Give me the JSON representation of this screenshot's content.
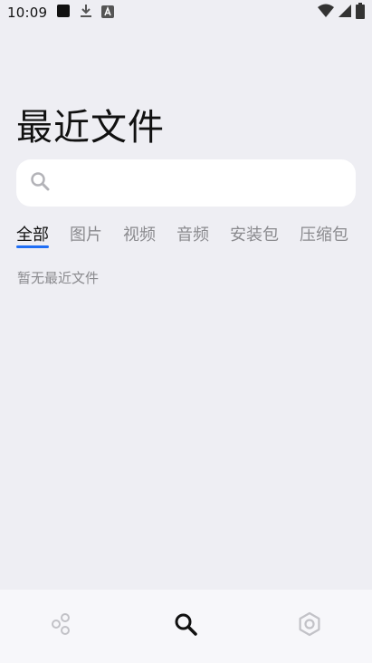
{
  "status_bar": {
    "time": "10:09",
    "left_icons": [
      "square-app-icon",
      "download-icon",
      "font-a-icon"
    ],
    "right_icons": [
      "wifi-icon",
      "signal-icon",
      "battery-icon"
    ]
  },
  "page": {
    "title": "最近文件",
    "empty_message": "暂无最近文件"
  },
  "search": {
    "placeholder": "",
    "value": ""
  },
  "tabs": [
    {
      "label": "全部",
      "active": true
    },
    {
      "label": "图片",
      "active": false
    },
    {
      "label": "视频",
      "active": false
    },
    {
      "label": "音频",
      "active": false
    },
    {
      "label": "安装包",
      "active": false
    },
    {
      "label": "压缩包",
      "active": false
    }
  ],
  "bottom_nav": {
    "items": [
      {
        "icon": "browse-icon",
        "active": false
      },
      {
        "icon": "search-icon",
        "active": true
      },
      {
        "icon": "settings-icon",
        "active": false
      }
    ]
  },
  "colors": {
    "background": "#eeeef3",
    "accent": "#1f6ef5",
    "inactive_text": "#8a8a8e",
    "nav_bar": "#f7f7fa"
  }
}
